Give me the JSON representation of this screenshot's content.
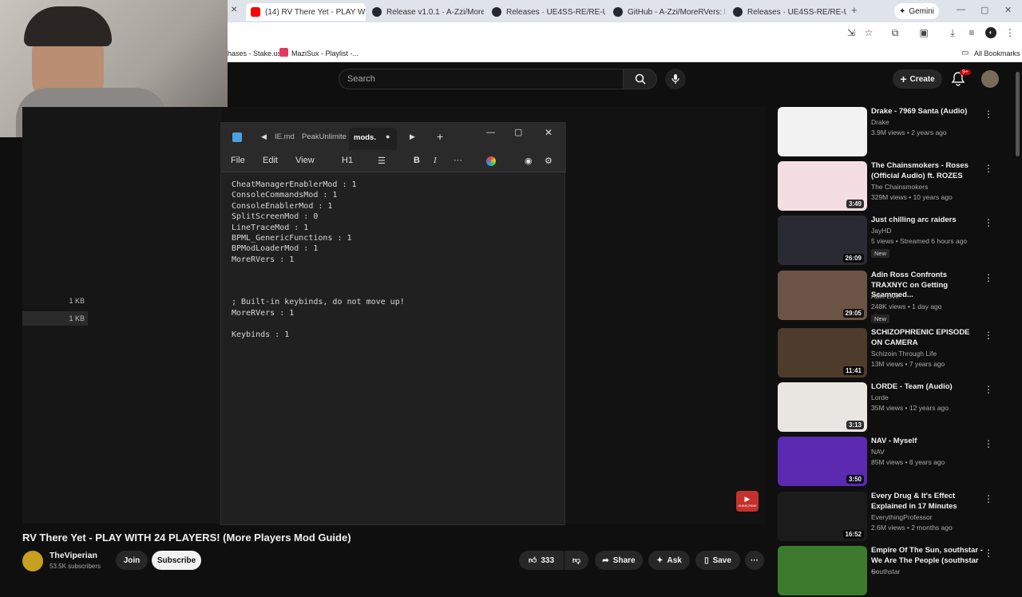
{
  "browser": {
    "tabs": [
      {
        "title": "(14) RV There Yet - PLAY WITH",
        "color": "#ff0000"
      },
      {
        "title": "Release v1.0.1 · A-Zzi/MoreR",
        "color": "#24292e"
      },
      {
        "title": "Releases · UE4SS-RE/RE-UE4S",
        "color": "#24292e"
      },
      {
        "title": "GitHub - A-Zzi/MoreRVers: h",
        "color": "#24292e"
      },
      {
        "title": "Releases · UE4SS-RE/RE-UE4S",
        "color": "#24292e"
      }
    ],
    "gemini_label": "Gemini",
    "bookmarks": [
      "hases - Stake.us",
      "MaziSux - Playlist -..."
    ],
    "all_bookmarks_label": "All Bookmarks"
  },
  "youtube": {
    "search_placeholder": "Search",
    "create_label": "Create",
    "notifications_badge": "9+"
  },
  "desktop": {
    "file_sizes": [
      "1 KB",
      "1 KB"
    ]
  },
  "notepad": {
    "tabs": [
      "IE.md",
      "PeakUnlimite",
      "mods."
    ],
    "menu": [
      "File",
      "Edit",
      "View"
    ],
    "heading_label": "H1",
    "lines": [
      "CheatManagerEnablerMod : 1",
      "ConsoleCommandsMod : 1",
      "ConsoleEnablerMod : 1",
      "SplitScreenMod : 0",
      "LineTraceMod : 1",
      "BPML_GenericFunctions : 1",
      "BPModLoaderMod : 1",
      "MoreRVers : 1",
      "",
      "",
      "",
      "; Built-in keybinds, do not move up!",
      "MoreRVers : 1",
      "",
      "Keybinds : 1"
    ]
  },
  "video": {
    "title": "RV There Yet - PLAY WITH 24 PLAYERS! (More Players Mod Guide)",
    "channel": "TheViperian",
    "subscribers": "53.5K subscribers",
    "join_label": "Join",
    "subscribe_label": "Subscribe",
    "likes": "333",
    "share_label": "Share",
    "ask_label": "Ask",
    "save_label": "Save",
    "watermark": "SUBSCRIBE"
  },
  "recommendations": [
    {
      "title": "Drake - 7969 Santa (Audio)",
      "channel": "Drake",
      "meta": "3.9M views • 2 years ago",
      "duration": "",
      "new": false,
      "thumb": "#f2f2f2"
    },
    {
      "title": "The Chainsmokers - Roses (Official Audio) ft. ROZES",
      "channel": "The Chainsmokers",
      "meta": "329M views • 10 years ago",
      "duration": "3:49",
      "new": false,
      "thumb": "#f4dde3"
    },
    {
      "title": "Just chilling arc raiders",
      "channel": "JayHD",
      "meta": "5 views • Streamed 6 hours ago",
      "duration": "26:09",
      "new": true,
      "thumb": "#2a2a33"
    },
    {
      "title": "Adin Ross Confronts TRAXNYC on Getting Scammed...",
      "channel": "Adin Live",
      "meta": "248K views • 1 day ago",
      "duration": "29:05",
      "new": true,
      "thumb": "#6b5446"
    },
    {
      "title": "SCHIZOPHRENIC EPISODE ON CAMERA",
      "channel": "Schizoin Through Life",
      "meta": "13M views • 7 years ago",
      "duration": "11:41",
      "new": false,
      "thumb": "#4d3b2c"
    },
    {
      "title": "LORDE - Team (Audio)",
      "channel": "Lorde",
      "meta": "35M views • 12 years ago",
      "duration": "3:13",
      "new": false,
      "thumb": "#e9e6e2"
    },
    {
      "title": "NAV - Myself",
      "channel": "NAV",
      "meta": "85M views • 8 years ago",
      "duration": "3:50",
      "new": false,
      "thumb": "#5b2ab0"
    },
    {
      "title": "Every Drug & It's Effect Explained in 17 Minutes",
      "channel": "EverythingProfessor",
      "meta": "2.6M views • 2 months ago",
      "duration": "16:52",
      "new": false,
      "thumb": "#1b1b1b"
    },
    {
      "title": "Empire Of The Sun, southstar - We Are The People (southstar ...",
      "channel": "Southstar",
      "meta": "",
      "duration": "",
      "new": false,
      "thumb": "#3d7a2e"
    }
  ]
}
